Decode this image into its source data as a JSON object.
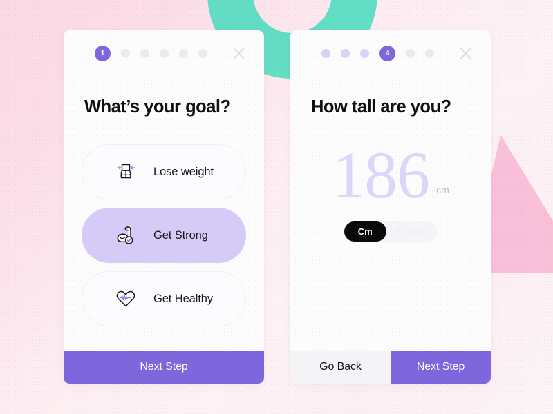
{
  "background": {
    "base_color": "#fce0e9",
    "shapes": [
      {
        "name": "teal-ring",
        "color": "#55dcc0"
      },
      {
        "name": "pink-triangle",
        "color": "#f9bcd6"
      }
    ]
  },
  "theme": {
    "accent": "#7e66dd",
    "accent_soft": "#d6caf7",
    "accent_pale": "#d9d2f7",
    "teal": "#55dcc0",
    "pink": "#f9bcd6",
    "dot_inactive": "#ebebee",
    "text_dark": "#0f0f14"
  },
  "cards": {
    "goal": {
      "stepper": {
        "total": 6,
        "current": 1,
        "current_label": "1",
        "dots": [
          {
            "state": "active",
            "label": "1"
          },
          {
            "state": "inactive",
            "label": ""
          },
          {
            "state": "inactive",
            "label": ""
          },
          {
            "state": "inactive",
            "label": ""
          },
          {
            "state": "inactive",
            "label": ""
          },
          {
            "state": "inactive",
            "label": ""
          }
        ]
      },
      "close_icon": "close-icon",
      "heading": "What’s your goal?",
      "options": [
        {
          "label": "Lose weight",
          "icon": "waist-measure-icon",
          "selected": false
        },
        {
          "label": "Get Strong",
          "icon": "flexed-bicep-icon",
          "selected": true
        },
        {
          "label": "Get Healthy",
          "icon": "heart-pulse-icon",
          "selected": false
        }
      ],
      "footer": {
        "buttons": [
          {
            "label": "Next Step",
            "style": "primary"
          }
        ]
      }
    },
    "height": {
      "stepper": {
        "total": 6,
        "current": 4,
        "current_label": "4",
        "dots": [
          {
            "state": "done",
            "label": ""
          },
          {
            "state": "done",
            "label": ""
          },
          {
            "state": "done",
            "label": ""
          },
          {
            "state": "active",
            "label": "4"
          },
          {
            "state": "inactive",
            "label": ""
          },
          {
            "state": "inactive",
            "label": ""
          }
        ]
      },
      "close_icon": "close-icon",
      "heading": "How tall are you?",
      "value": "186",
      "unit_suffix": "cm",
      "unit_toggle": {
        "selected": "Cm",
        "options": [
          {
            "label": "Cm",
            "active": true
          },
          {
            "label": "Ft & In",
            "active": false
          }
        ]
      },
      "footer": {
        "buttons": [
          {
            "label": "Go Back",
            "style": "secondary"
          },
          {
            "label": "Next Step",
            "style": "primary"
          }
        ]
      }
    }
  }
}
